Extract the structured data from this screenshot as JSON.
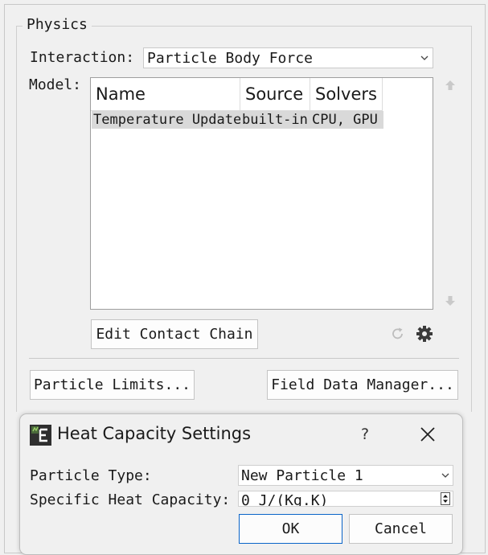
{
  "physics": {
    "group_title": "Physics",
    "interaction_label": "Interaction:",
    "interaction_value": "Particle Body Force",
    "model_label": "Model:",
    "model_table": {
      "headers": [
        "Name",
        "Source",
        "Solvers"
      ],
      "rows": [
        {
          "name": "Temperature Update",
          "source": "built-in",
          "solvers": "CPU, GPU"
        }
      ]
    },
    "edit_contact_chain_label": "Edit Contact Chain",
    "particle_limits_label": "Particle Limits...",
    "field_data_manager_label": "Field Data Manager..."
  },
  "dialog": {
    "title": "Heat Capacity Settings",
    "help_label": "?",
    "particle_type_label": "Particle Type:",
    "particle_type_value": "New Particle 1",
    "specific_heat_label": "Specific Heat Capacity:",
    "specific_heat_value": "0 J/(Kg.K)",
    "ok_label": "OK",
    "cancel_label": "Cancel"
  },
  "colors": {
    "background": "#f0f0f0",
    "selected_row": "#d9d9d9",
    "focus_border": "#0a64c8",
    "icon_gray": "#bdbdbd"
  },
  "icons": [
    "chevron-down-icon",
    "scroll-up-icon",
    "scroll-down-icon",
    "refresh-icon",
    "gear-icon",
    "app-icon",
    "help-icon",
    "close-icon",
    "spin-arrows-icon"
  ]
}
